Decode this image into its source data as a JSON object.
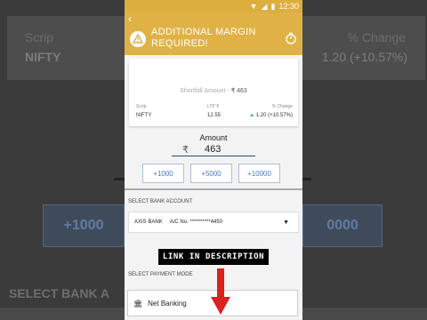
{
  "background": {
    "scrip_label": "Scrip",
    "scrip_value": "NIFTY",
    "pct_label": "% Change",
    "pct_value": "1.20 (+10.57%)",
    "btn_left": "+1000",
    "btn_right": "0000",
    "select_bank": "SELECT BANK A"
  },
  "status": {
    "time": "12:30"
  },
  "header": {
    "title": "ADDITIONAL MARGIN REQUIRED!",
    "back_icon": "back-arrow-icon",
    "warn_icon": "warning-icon",
    "timer_icon": "timer-icon"
  },
  "card": {
    "shortfall_label": "Shortfall Amount -",
    "shortfall_value": "₹ 463",
    "scrip_label": "Scrip",
    "scrip_value": "NIFTY",
    "ltp_label": "LTP ₹",
    "ltp_value": "12.55",
    "change_label": "% Change",
    "change_value": "1.20 (+10.57%)"
  },
  "amount": {
    "label": "Amount",
    "currency": "₹",
    "value": "463"
  },
  "quick_add": [
    "+1000",
    "+5000",
    "+10000"
  ],
  "bank": {
    "section_label": "SELECT BANK ACCOUNT",
    "name": "AXIS BANK",
    "account": "A/C No. **********4450"
  },
  "banner": {
    "text": "LINK IN DESCRIPTION"
  },
  "payment": {
    "section_label": "SELECT PAYMENT MODE",
    "method": "Net Banking"
  },
  "colors": {
    "accent": "#e0b246",
    "link": "#4a79bf",
    "up": "#2bb26b"
  }
}
